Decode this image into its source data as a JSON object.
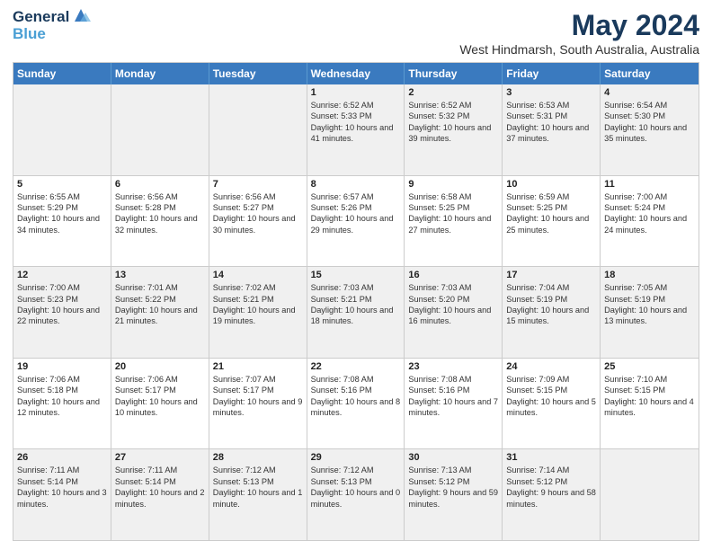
{
  "logo": {
    "line1": "General",
    "line2": "Blue"
  },
  "title": "May 2024",
  "location": "West Hindmarsh, South Australia, Australia",
  "days_header": [
    "Sunday",
    "Monday",
    "Tuesday",
    "Wednesday",
    "Thursday",
    "Friday",
    "Saturday"
  ],
  "weeks": [
    [
      {
        "day": "",
        "empty": true
      },
      {
        "day": "",
        "empty": true
      },
      {
        "day": "",
        "empty": true
      },
      {
        "day": "1",
        "sunrise": "6:52 AM",
        "sunset": "5:33 PM",
        "daylight": "10 hours and 41 minutes."
      },
      {
        "day": "2",
        "sunrise": "6:52 AM",
        "sunset": "5:32 PM",
        "daylight": "10 hours and 39 minutes."
      },
      {
        "day": "3",
        "sunrise": "6:53 AM",
        "sunset": "5:31 PM",
        "daylight": "10 hours and 37 minutes."
      },
      {
        "day": "4",
        "sunrise": "6:54 AM",
        "sunset": "5:30 PM",
        "daylight": "10 hours and 35 minutes."
      }
    ],
    [
      {
        "day": "5",
        "sunrise": "6:55 AM",
        "sunset": "5:29 PM",
        "daylight": "10 hours and 34 minutes."
      },
      {
        "day": "6",
        "sunrise": "6:56 AM",
        "sunset": "5:28 PM",
        "daylight": "10 hours and 32 minutes."
      },
      {
        "day": "7",
        "sunrise": "6:56 AM",
        "sunset": "5:27 PM",
        "daylight": "10 hours and 30 minutes."
      },
      {
        "day": "8",
        "sunrise": "6:57 AM",
        "sunset": "5:26 PM",
        "daylight": "10 hours and 29 minutes."
      },
      {
        "day": "9",
        "sunrise": "6:58 AM",
        "sunset": "5:25 PM",
        "daylight": "10 hours and 27 minutes."
      },
      {
        "day": "10",
        "sunrise": "6:59 AM",
        "sunset": "5:25 PM",
        "daylight": "10 hours and 25 minutes."
      },
      {
        "day": "11",
        "sunrise": "7:00 AM",
        "sunset": "5:24 PM",
        "daylight": "10 hours and 24 minutes."
      }
    ],
    [
      {
        "day": "12",
        "sunrise": "7:00 AM",
        "sunset": "5:23 PM",
        "daylight": "10 hours and 22 minutes."
      },
      {
        "day": "13",
        "sunrise": "7:01 AM",
        "sunset": "5:22 PM",
        "daylight": "10 hours and 21 minutes."
      },
      {
        "day": "14",
        "sunrise": "7:02 AM",
        "sunset": "5:21 PM",
        "daylight": "10 hours and 19 minutes."
      },
      {
        "day": "15",
        "sunrise": "7:03 AM",
        "sunset": "5:21 PM",
        "daylight": "10 hours and 18 minutes."
      },
      {
        "day": "16",
        "sunrise": "7:03 AM",
        "sunset": "5:20 PM",
        "daylight": "10 hours and 16 minutes."
      },
      {
        "day": "17",
        "sunrise": "7:04 AM",
        "sunset": "5:19 PM",
        "daylight": "10 hours and 15 minutes."
      },
      {
        "day": "18",
        "sunrise": "7:05 AM",
        "sunset": "5:19 PM",
        "daylight": "10 hours and 13 minutes."
      }
    ],
    [
      {
        "day": "19",
        "sunrise": "7:06 AM",
        "sunset": "5:18 PM",
        "daylight": "10 hours and 12 minutes."
      },
      {
        "day": "20",
        "sunrise": "7:06 AM",
        "sunset": "5:17 PM",
        "daylight": "10 hours and 10 minutes."
      },
      {
        "day": "21",
        "sunrise": "7:07 AM",
        "sunset": "5:17 PM",
        "daylight": "10 hours and 9 minutes."
      },
      {
        "day": "22",
        "sunrise": "7:08 AM",
        "sunset": "5:16 PM",
        "daylight": "10 hours and 8 minutes."
      },
      {
        "day": "23",
        "sunrise": "7:08 AM",
        "sunset": "5:16 PM",
        "daylight": "10 hours and 7 minutes."
      },
      {
        "day": "24",
        "sunrise": "7:09 AM",
        "sunset": "5:15 PM",
        "daylight": "10 hours and 5 minutes."
      },
      {
        "day": "25",
        "sunrise": "7:10 AM",
        "sunset": "5:15 PM",
        "daylight": "10 hours and 4 minutes."
      }
    ],
    [
      {
        "day": "26",
        "sunrise": "7:11 AM",
        "sunset": "5:14 PM",
        "daylight": "10 hours and 3 minutes."
      },
      {
        "day": "27",
        "sunrise": "7:11 AM",
        "sunset": "5:14 PM",
        "daylight": "10 hours and 2 minutes."
      },
      {
        "day": "28",
        "sunrise": "7:12 AM",
        "sunset": "5:13 PM",
        "daylight": "10 hours and 1 minute."
      },
      {
        "day": "29",
        "sunrise": "7:12 AM",
        "sunset": "5:13 PM",
        "daylight": "10 hours and 0 minutes."
      },
      {
        "day": "30",
        "sunrise": "7:13 AM",
        "sunset": "5:12 PM",
        "daylight": "9 hours and 59 minutes."
      },
      {
        "day": "31",
        "sunrise": "7:14 AM",
        "sunset": "5:12 PM",
        "daylight": "9 hours and 58 minutes."
      },
      {
        "day": "",
        "empty": true
      }
    ]
  ],
  "labels": {
    "sunrise_prefix": "Sunrise: ",
    "sunset_prefix": "Sunset: ",
    "daylight_prefix": "Daylight: "
  }
}
